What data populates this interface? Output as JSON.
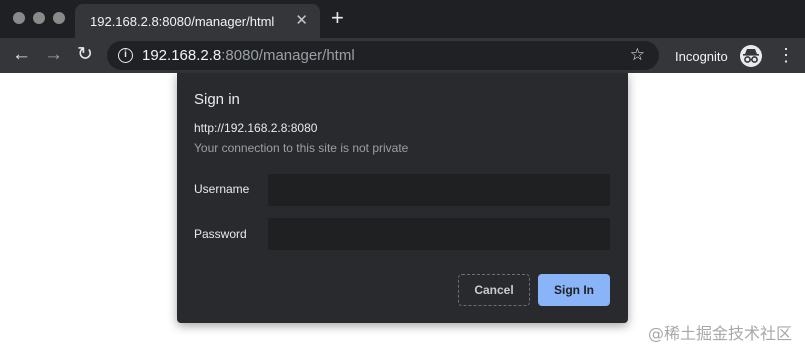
{
  "browser": {
    "tab": {
      "title": "192.168.2.8:8080/manager/html",
      "close_glyph": "✕"
    },
    "new_tab_glyph": "+",
    "nav": {
      "back_glyph": "←",
      "forward_glyph": "→",
      "reload_glyph": "↻"
    },
    "omnibox": {
      "info_glyph": "i",
      "url_host": "192.168.2.8",
      "url_rest": ":8080/manager/html",
      "star_glyph": "☆"
    },
    "incognito_label": "Incognito",
    "menu_glyph": "⋮"
  },
  "dialog": {
    "title": "Sign in",
    "origin": "http://192.168.2.8:8080",
    "warning": "Your connection to this site is not private",
    "username_label": "Username",
    "username_value": "",
    "password_label": "Password",
    "password_value": "",
    "cancel_label": "Cancel",
    "signin_label": "Sign In"
  },
  "watermark": "@稀土掘金技术社区",
  "icons": [
    "info-icon",
    "star-icon",
    "incognito-icon",
    "back-icon",
    "forward-icon",
    "reload-icon",
    "close-icon",
    "plus-icon",
    "kebab-menu-icon"
  ],
  "colors": {
    "accent": "#8ab4f8",
    "dialog_bg": "#292a2d",
    "toolbar_bg": "#35363a",
    "tabstrip_bg": "#1f2023"
  }
}
